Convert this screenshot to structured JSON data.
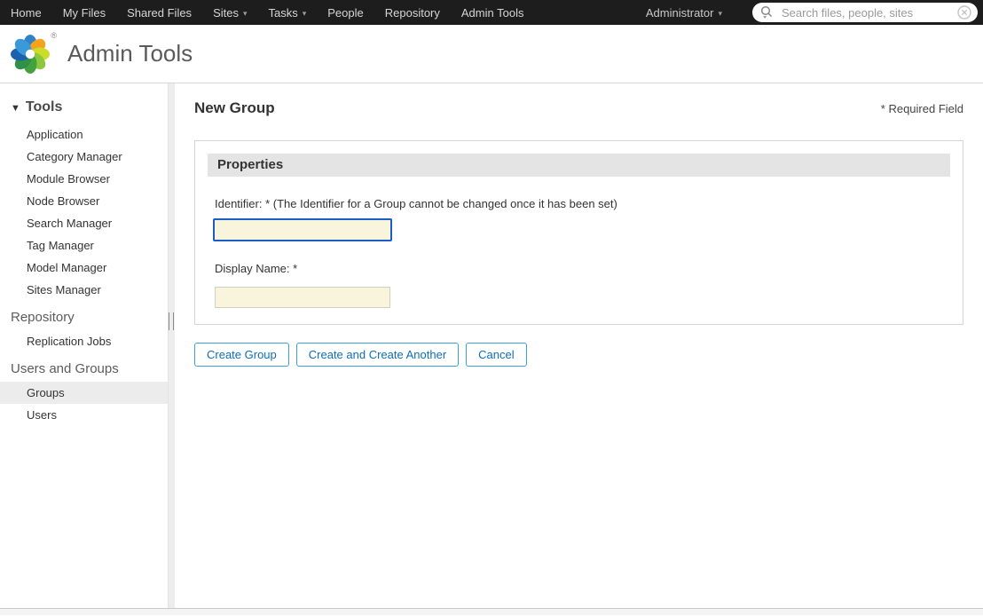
{
  "topnav": {
    "items": [
      {
        "label": "Home",
        "dropdown": false
      },
      {
        "label": "My Files",
        "dropdown": false
      },
      {
        "label": "Shared Files",
        "dropdown": false
      },
      {
        "label": "Sites",
        "dropdown": true
      },
      {
        "label": "Tasks",
        "dropdown": true
      },
      {
        "label": "People",
        "dropdown": false
      },
      {
        "label": "Repository",
        "dropdown": false
      },
      {
        "label": "Admin Tools",
        "dropdown": false
      }
    ],
    "user_menu": {
      "label": "Administrator"
    },
    "search": {
      "placeholder": "Search files, people, sites",
      "value": ""
    }
  },
  "header": {
    "title": "Admin Tools"
  },
  "sidebar": {
    "tools_header": "Tools",
    "tools_items": [
      "Application",
      "Category Manager",
      "Module Browser",
      "Node Browser",
      "Search Manager",
      "Tag Manager",
      "Model Manager",
      "Sites Manager"
    ],
    "repository_header": "Repository",
    "repository_items": [
      "Replication Jobs"
    ],
    "users_groups_header": "Users and Groups",
    "users_groups_items": [
      "Groups",
      "Users"
    ],
    "selected_item": "Groups"
  },
  "main": {
    "title": "New Group",
    "required_note": "* Required Field",
    "panel": {
      "header": "Properties",
      "identifier_label": "Identifier: * (The Identifier for a Group cannot be changed once it has been set)",
      "identifier_value": "",
      "display_name_label": "Display Name: *",
      "display_name_value": ""
    },
    "buttons": [
      "Create Group",
      "Create and Create Another",
      "Cancel"
    ]
  },
  "icons": {
    "caret_down": "▾",
    "tools_caret": "▼",
    "registered": "®"
  },
  "colors": {
    "nav_bg": "#1d1d1d",
    "selected_item_bg": "#ececec",
    "panel_header_bg": "#e4e4e4",
    "input_bg": "#f9f5dc",
    "focus_border": "#1c5cc5",
    "button_border": "#3ba0dc",
    "button_text": "#0d6fb8"
  }
}
